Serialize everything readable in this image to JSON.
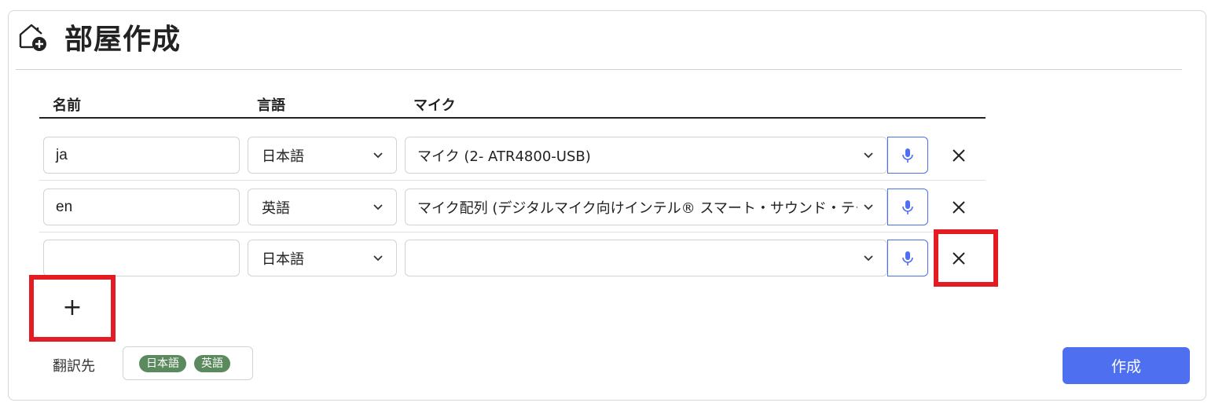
{
  "header": {
    "title": "部屋作成",
    "icon": "home-add-icon"
  },
  "columns": {
    "name": "名前",
    "language": "言語",
    "mic": "マイク"
  },
  "rows": [
    {
      "name": "ja",
      "language": "日本語",
      "mic": "マイク (2- ATR4800-USB)"
    },
    {
      "name": "en",
      "language": "英語",
      "mic": "マイク配列 (デジタルマイク向けインテル® スマート・サウンド・テクノロジー)"
    },
    {
      "name": "",
      "language": "日本語",
      "mic": ""
    }
  ],
  "add_button": {
    "label": "+"
  },
  "translation": {
    "label": "翻訳先",
    "targets": [
      "日本語",
      "英語"
    ]
  },
  "create_button": {
    "label": "作成"
  },
  "colors": {
    "accent": "#4d6ff0",
    "chip": "#5b8a5e",
    "highlight": "#e31b23"
  }
}
